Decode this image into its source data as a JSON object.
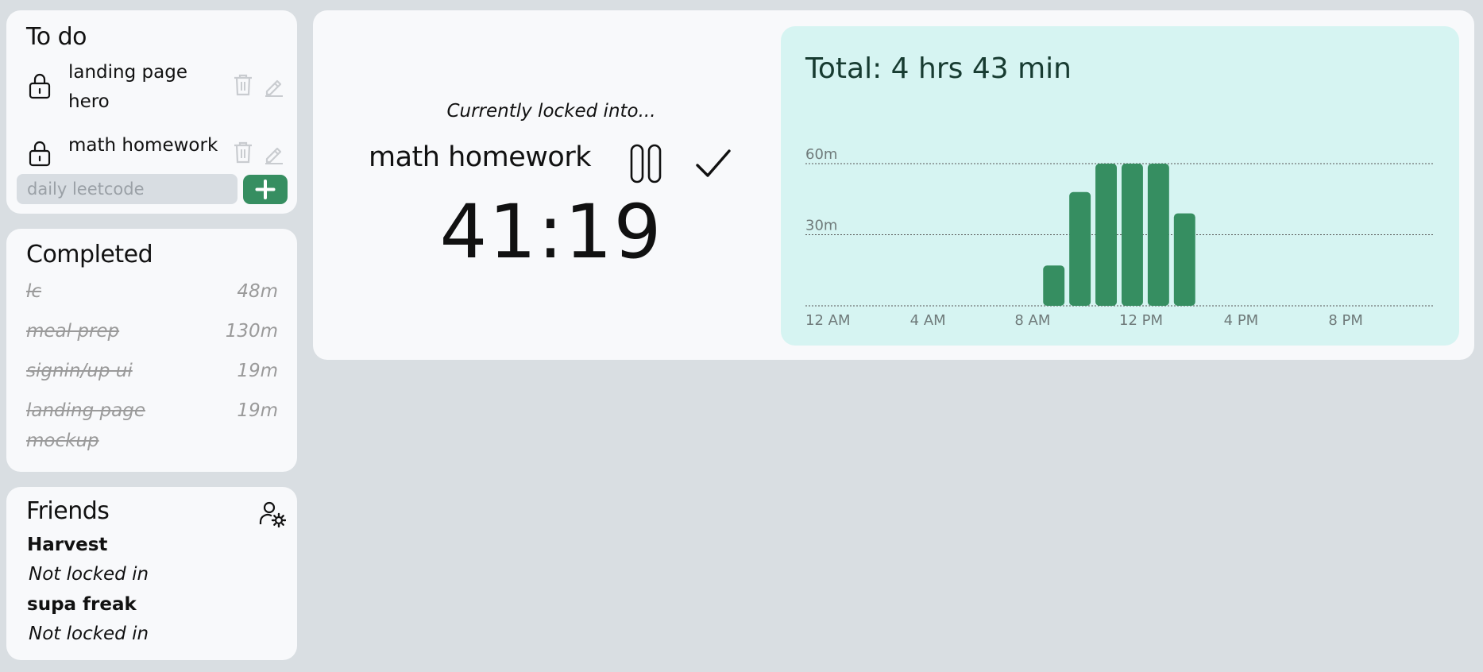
{
  "todo": {
    "title": "To do",
    "items": [
      {
        "label": "landing page hero"
      },
      {
        "label": "math homework"
      }
    ],
    "new_todo": {
      "value": "",
      "placeholder": "daily leetcode"
    }
  },
  "completed": {
    "title": "Completed",
    "items": [
      {
        "name": "lc",
        "time": "48m"
      },
      {
        "name": "meal prep",
        "time": "130m"
      },
      {
        "name": "signin/up ui",
        "time": "19m"
      },
      {
        "name": "landing page mockup",
        "time": "19m"
      }
    ]
  },
  "friends": {
    "title": "Friends",
    "items": [
      {
        "name": "Harvest",
        "status": "Not locked in"
      },
      {
        "name": "supa freak",
        "status": "Not locked in"
      }
    ]
  },
  "session": {
    "caption": "Currently locked into...",
    "task": "math homework",
    "timer": "41:19"
  },
  "stats": {
    "total": "Total: 4 hrs 43 min"
  },
  "colors": {
    "accent": "#368e61",
    "stats_bg": "#d6f4f2",
    "page_bg": "#d9dee2",
    "card_bg": "#f8f9fb"
  },
  "chart_data": {
    "type": "bar",
    "x_ticks": [
      "12 AM",
      "4 AM",
      "8 AM",
      "12 PM",
      "4 PM",
      "8 PM"
    ],
    "y_ticks": [
      "30m",
      "60m"
    ],
    "ylim": [
      0,
      60
    ],
    "grid": true,
    "categories": [
      "12 AM",
      "1 AM",
      "2 AM",
      "3 AM",
      "4 AM",
      "5 AM",
      "6 AM",
      "7 AM",
      "8 AM",
      "9 AM",
      "10 AM",
      "11 AM",
      "12 PM",
      "1 PM",
      "2 PM",
      "3 PM",
      "4 PM",
      "5 PM",
      "6 PM",
      "7 PM",
      "8 PM",
      "9 PM",
      "10 PM",
      "11 PM"
    ],
    "values": [
      0,
      0,
      0,
      0,
      0,
      0,
      0,
      0,
      0,
      17,
      48,
      60,
      60,
      60,
      39,
      0,
      0,
      0,
      0,
      0,
      0,
      0,
      0,
      0
    ]
  }
}
